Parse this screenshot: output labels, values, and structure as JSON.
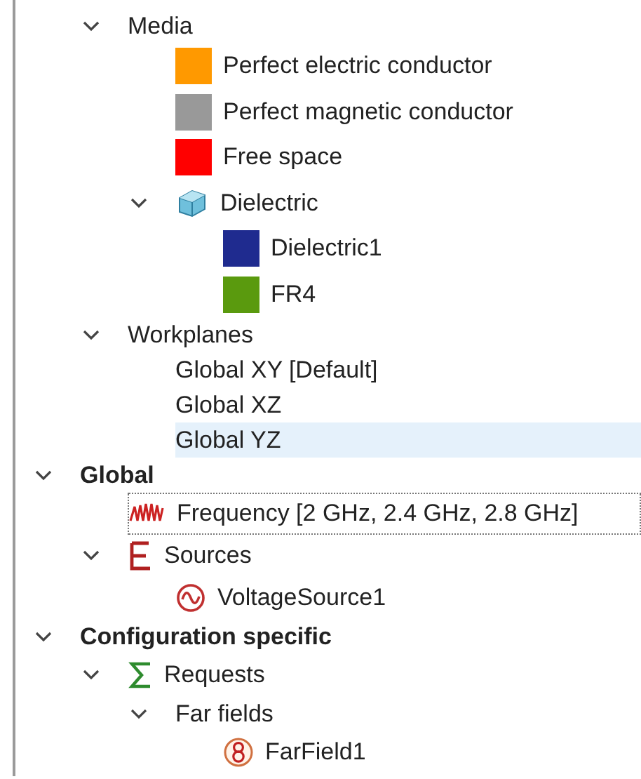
{
  "tree": [
    {
      "children": [
        {
          "label": "Media",
          "expanded": true,
          "children": [
            {
              "label": "Perfect electric conductor",
              "kind": "swatch",
              "color": "#ff9900"
            },
            {
              "label": "Perfect magnetic conductor",
              "kind": "swatch",
              "color": "#999999"
            },
            {
              "label": "Free space",
              "kind": "swatch",
              "color": "#ff0000"
            },
            {
              "label": "Dielectric",
              "kind": "cube",
              "expanded": true,
              "children": [
                {
                  "label": "Dielectric1",
                  "kind": "swatch",
                  "color": "#1f2b8f"
                },
                {
                  "label": "FR4",
                  "kind": "swatch",
                  "color": "#5a9a0e"
                }
              ]
            }
          ]
        },
        {
          "label": "Workplanes",
          "expanded": true,
          "children": [
            {
              "label": "Global XY [Default]",
              "selected": false
            },
            {
              "label": "Global XZ",
              "selected": false
            },
            {
              "label": "Global YZ",
              "selected": true
            }
          ]
        }
      ]
    },
    {
      "label": "Global",
      "bold": true,
      "expanded": true,
      "children": [
        {
          "label": "Frequency [2 GHz, 2.4 GHz, 2.8 GHz]",
          "kind": "wave",
          "focused": true
        },
        {
          "label": "Sources",
          "kind": "letter-e",
          "expanded": true,
          "children": [
            {
              "label": "VoltageSource1",
              "kind": "source"
            }
          ]
        }
      ]
    },
    {
      "label": "Configuration specific",
      "bold": true,
      "expanded": true,
      "children": [
        {
          "label": "Requests",
          "kind": "sigma",
          "expanded": true,
          "children": [
            {
              "label": "Far fields",
              "expanded": true,
              "children": [
                {
                  "label": "FarField1",
                  "kind": "farfield"
                }
              ]
            }
          ]
        }
      ]
    }
  ]
}
